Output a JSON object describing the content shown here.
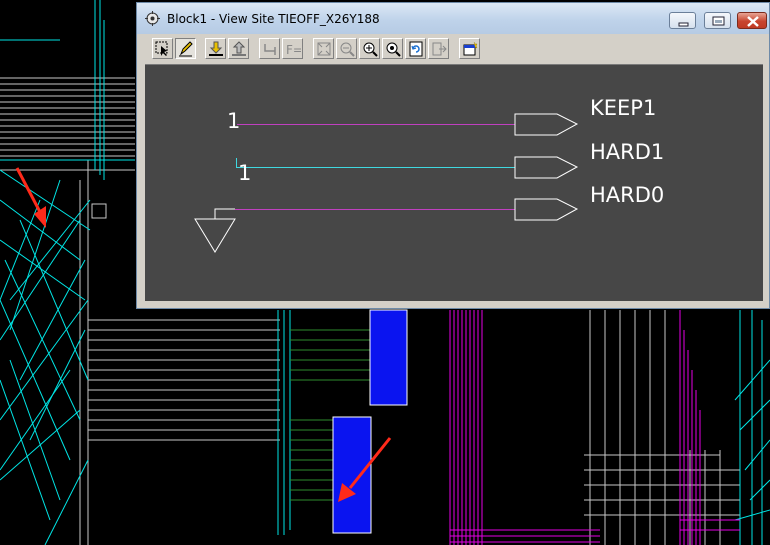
{
  "window": {
    "title": "Block1 - View Site TIEOFF_X26Y188",
    "controls": [
      "minimize",
      "maximize",
      "close"
    ]
  },
  "toolbar": {
    "buttons": [
      {
        "name": "select-icon"
      },
      {
        "name": "edit-pencil-icon",
        "pressed": true
      },
      {
        "name": "push-down-icon"
      },
      {
        "name": "pop-up-icon"
      },
      {
        "name": "route-icon"
      },
      {
        "name": "function-icon"
      },
      {
        "name": "zoom-fit-icon"
      },
      {
        "name": "zoom-out-icon"
      },
      {
        "name": "zoom-in-icon"
      },
      {
        "name": "zoom-area-icon"
      },
      {
        "name": "refresh-icon"
      },
      {
        "name": "import-icon"
      },
      {
        "name": "properties-icon"
      }
    ]
  },
  "schematic": {
    "labels": {
      "keep1_source": "1",
      "hard1_source": "1",
      "port_keep1": "KEEP1",
      "port_hard1": "HARD1",
      "port_hard0": "HARD0"
    },
    "net_colors": {
      "keep1": "#c040c0",
      "hard1": "#40d8e0",
      "hard0": "#c040c0"
    },
    "canvas_color": "#474747"
  },
  "background": {
    "colors": {
      "cyan": "#00e5e5",
      "magenta": "#e600e6",
      "blue": "#0a14f0",
      "green": "#2e8b2e",
      "arrow": "#ff2a1a",
      "gray": "#c8c8c8"
    }
  }
}
